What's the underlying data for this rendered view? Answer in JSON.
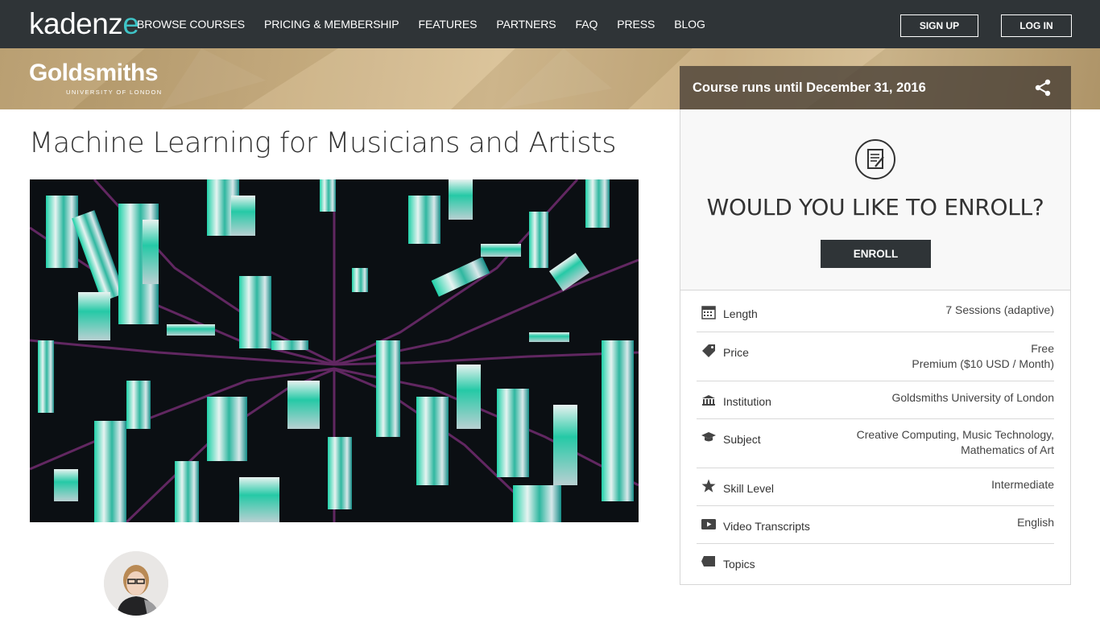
{
  "nav": {
    "logo_main": "kadenz",
    "logo_accent": "e",
    "links": [
      "BROWSE COURSES",
      "PRICING & MEMBERSHIP",
      "FEATURES",
      "PARTNERS",
      "FAQ",
      "PRESS",
      "BLOG"
    ],
    "signup": "SIGN UP",
    "login": "LOG IN"
  },
  "banner": {
    "institution_name": "Goldsmiths",
    "institution_sub": "UNIVERSITY OF LONDON"
  },
  "course": {
    "title": "Machine Learning for Musicians and Artists"
  },
  "sidebar": {
    "runs_until": "Course runs until December 31, 2016",
    "enroll_question": "WOULD YOU LIKE TO ENROLL?",
    "enroll_button": "ENROLL",
    "details": [
      {
        "icon": "calendar-icon",
        "label": "Length",
        "value": [
          "7 Sessions (adaptive)"
        ]
      },
      {
        "icon": "tag-icon",
        "label": "Price",
        "value": [
          "Free",
          "Premium ($10 USD / Month)"
        ]
      },
      {
        "icon": "institution-icon",
        "label": "Institution",
        "value": [
          "Goldsmiths University of London"
        ]
      },
      {
        "icon": "graduation-cap-icon",
        "label": "Subject",
        "value": [
          "Creative Computing, Music Technology,",
          "Mathematics of Art"
        ]
      },
      {
        "icon": "star-icon",
        "label": "Skill Level",
        "value": [
          "Intermediate"
        ]
      },
      {
        "icon": "video-icon",
        "label": "Video Transcripts",
        "value": [
          "English"
        ]
      },
      {
        "icon": "topics-tag-icon",
        "label": "Topics",
        "value": []
      }
    ]
  },
  "colors": {
    "nav_bg": "#2f3437",
    "accent": "#3fc4c7",
    "banner_gold": "#c9ae80",
    "runs_bar": "#5a5045"
  }
}
